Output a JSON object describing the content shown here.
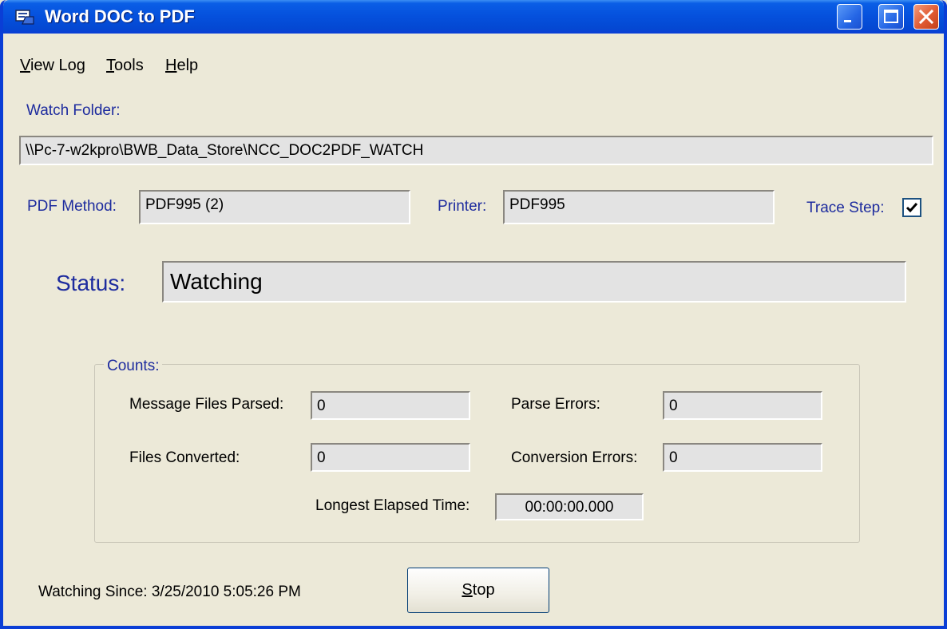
{
  "window": {
    "title": "Word DOC to PDF"
  },
  "menu": {
    "view_log_u": "V",
    "view_log_rest": "iew Log",
    "tools_u": "T",
    "tools_rest": "ools",
    "help_u": "H",
    "help_rest": "elp"
  },
  "watch_folder": {
    "label": "Watch Folder:",
    "value": "\\\\Pc-7-w2kpro\\BWB_Data_Store\\NCC_DOC2PDF_WATCH"
  },
  "pdf_method": {
    "label": "PDF Method:",
    "value": "PDF995 (2)"
  },
  "printer": {
    "label": "Printer:",
    "value": "PDF995"
  },
  "trace_step": {
    "label": "Trace Step:",
    "checked": true
  },
  "status": {
    "label": "Status:",
    "value": "Watching"
  },
  "counts": {
    "title": "Counts:",
    "message_files_parsed_label": "Message Files Parsed:",
    "message_files_parsed": "0",
    "parse_errors_label": "Parse Errors:",
    "parse_errors": "0",
    "files_converted_label": "Files Converted:",
    "files_converted": "0",
    "conversion_errors_label": "Conversion Errors:",
    "conversion_errors": "0",
    "longest_elapsed_label": "Longest Elapsed Time:",
    "longest_elapsed": "00:00:00.000"
  },
  "footer": {
    "watching_since": "Watching Since:  3/25/2010 5:05:26 PM",
    "stop_u": "S",
    "stop_rest": "top"
  },
  "colors": {
    "title_bar": "#0550dc",
    "dialog_bg": "#ece9d8",
    "label_blue": "#1d2b9e",
    "field_bg": "#e3e3e3"
  }
}
